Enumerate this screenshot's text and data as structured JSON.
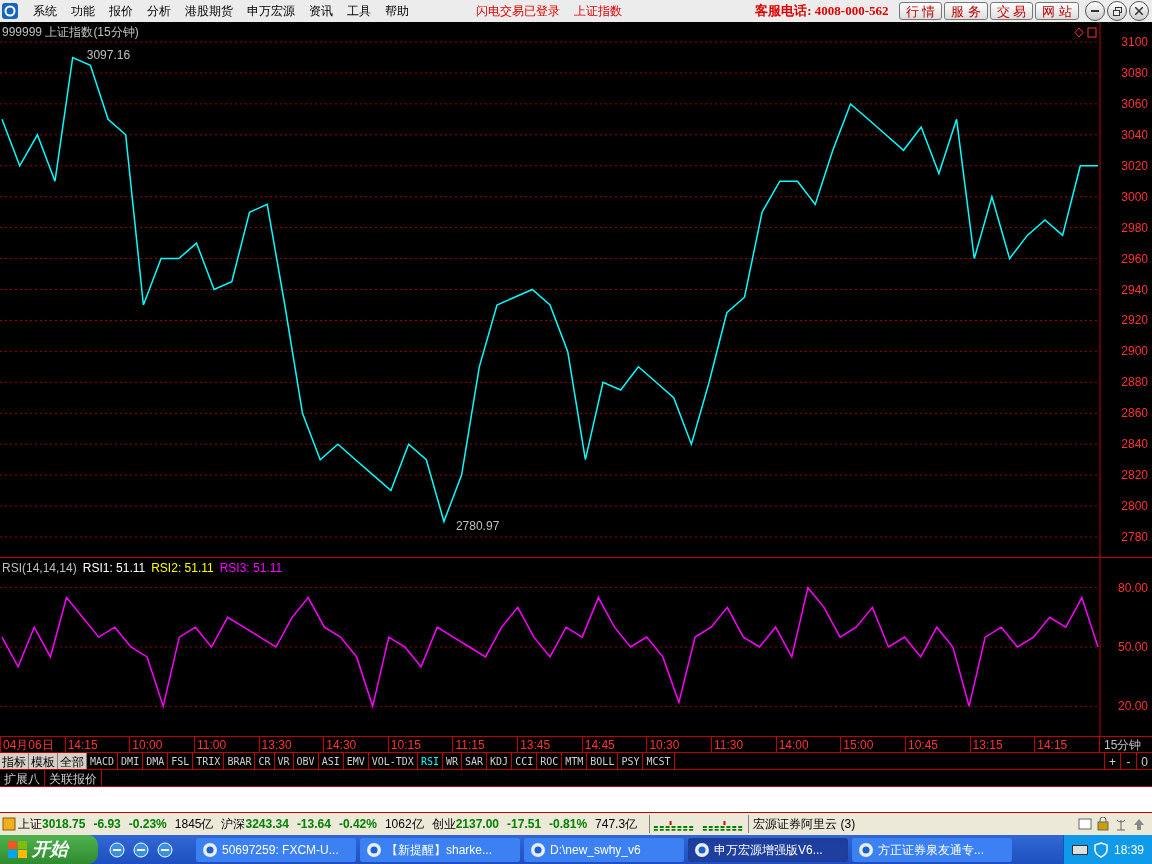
{
  "menu": {
    "items": [
      "系统",
      "功能",
      "报价",
      "分析",
      "港股期货",
      "申万宏源",
      "资讯",
      "工具",
      "帮助"
    ],
    "status": [
      "闪电交易已登录",
      "上证指数"
    ],
    "hotline": "客服电话: 4008-000-562",
    "buttons": [
      "行 情",
      "服 务",
      "交 易",
      "网 站"
    ]
  },
  "price_panel": {
    "title": "999999 上证指数(15分钟)",
    "high_label": "3097.16",
    "low_label": "2780.97",
    "chart_data": {
      "type": "line",
      "grid": true,
      "ylim": [
        2780,
        3100
      ],
      "yticks": [
        2780,
        2800,
        2820,
        2840,
        2860,
        2880,
        2900,
        2920,
        2940,
        2960,
        2980,
        3000,
        3020,
        3040,
        3060,
        3080,
        3100
      ],
      "series": [
        {
          "color": "#00ffff",
          "values": [
            3050,
            3020,
            3040,
            3010,
            3090,
            3085,
            3050,
            3040,
            2930,
            2960,
            2960,
            2970,
            2940,
            2945,
            2990,
            2995,
            2930,
            2860,
            2830,
            2840,
            2830,
            2820,
            2810,
            2840,
            2830,
            2790,
            2820,
            2890,
            2930,
            2935,
            2940,
            2930,
            2900,
            2830,
            2880,
            2875,
            2890,
            2880,
            2870,
            2840,
            2880,
            2925,
            2935,
            2990,
            3010,
            3010,
            2995,
            3030,
            3060,
            3050,
            3040,
            3030,
            3045,
            3015,
            3050,
            2960,
            3000,
            2960,
            2975,
            2985,
            2975,
            3020,
            3020
          ]
        }
      ]
    }
  },
  "rsi_panel": {
    "legend": [
      {
        "label": "RSI(14,14,14)",
        "color": "#c0c0c0"
      },
      {
        "label": "RSI1: 51.11",
        "color": "#ffffff"
      },
      {
        "label": "RSI2: 51.11",
        "color": "#ffff00"
      },
      {
        "label": "RSI3: 51.11",
        "color": "#ff00ff"
      }
    ],
    "chart_data": {
      "type": "line",
      "grid": true,
      "ylim": [
        5,
        95
      ],
      "yticks": [
        {
          "value": 20,
          "label": "20.00"
        },
        {
          "value": 50,
          "label": "50.00"
        },
        {
          "value": 80,
          "label": "80.00"
        }
      ],
      "series": [
        {
          "color": "#ff00ff",
          "values": [
            55,
            40,
            60,
            45,
            75,
            65,
            55,
            60,
            50,
            45,
            20,
            55,
            60,
            50,
            65,
            60,
            55,
            50,
            65,
            75,
            60,
            55,
            45,
            20,
            55,
            50,
            40,
            60,
            55,
            50,
            45,
            60,
            70,
            55,
            45,
            60,
            55,
            75,
            60,
            50,
            55,
            45,
            22,
            55,
            60,
            70,
            55,
            50,
            60,
            45,
            80,
            70,
            55,
            60,
            70,
            50,
            55,
            45,
            60,
            50,
            20,
            55,
            60,
            50,
            55,
            65,
            60,
            75,
            50
          ]
        }
      ]
    }
  },
  "time_axis": {
    "labels": [
      "04月06日",
      "14:15",
      "10:00",
      "11:00",
      "13:30",
      "14:30",
      "10:15",
      "11:15",
      "13:45",
      "14:45",
      "10:30",
      "11:30",
      "14:00",
      "15:00",
      "10:45",
      "13:15",
      "14:15"
    ],
    "period": "15分钟"
  },
  "indicator_tabs": {
    "groups": [
      "指标",
      "模板",
      "全部"
    ],
    "tabs": [
      {
        "label": "MACD",
        "selected": false
      },
      {
        "label": "DMI",
        "selected": false
      },
      {
        "label": "DMA",
        "selected": false
      },
      {
        "label": "FSL",
        "selected": false
      },
      {
        "label": "TRIX",
        "selected": false
      },
      {
        "label": "BRAR",
        "selected": false
      },
      {
        "label": "CR",
        "selected": false
      },
      {
        "label": "VR",
        "selected": false
      },
      {
        "label": "OBV",
        "selected": false
      },
      {
        "label": "ASI",
        "selected": false
      },
      {
        "label": "EMV",
        "selected": false
      },
      {
        "label": "VOL-TDX",
        "selected": false
      },
      {
        "label": "RSI",
        "selected": true
      },
      {
        "label": "WR",
        "selected": false
      },
      {
        "label": "SAR",
        "selected": false
      },
      {
        "label": "KDJ",
        "selected": false
      },
      {
        "label": "CCI",
        "selected": false
      },
      {
        "label": "ROC",
        "selected": false
      },
      {
        "label": "MTM",
        "selected": false
      },
      {
        "label": "BOLL",
        "selected": false
      },
      {
        "label": "PSY",
        "selected": false
      },
      {
        "label": "MCST",
        "selected": false
      }
    ],
    "zoom": [
      "+",
      "-",
      "0"
    ]
  },
  "bottom_tabs": [
    "扩展八",
    "关联报价"
  ],
  "status_bar": {
    "indices": [
      {
        "name": "上证",
        "value": "3018.75",
        "change": "-6.93",
        "pct": "-0.23%",
        "amount": "1845亿"
      },
      {
        "name": "沪深",
        "value": "3243.34",
        "change": "-13.64",
        "pct": "-0.42%",
        "amount": "1062亿"
      },
      {
        "name": "创业",
        "value": "2137.00",
        "change": "-17.51",
        "pct": "-0.81%",
        "amount": "747.3亿"
      }
    ],
    "server": "宏源证券阿里云 (3)"
  },
  "taskbar": {
    "start": "开始",
    "tasks": [
      {
        "label": "50697259: FXCM-U...",
        "selected": false
      },
      {
        "label": "【新提醒】sharke...",
        "selected": false
      },
      {
        "label": "D:\\new_swhy_v6",
        "selected": false
      },
      {
        "label": "申万宏源增强版V6...",
        "selected": true
      },
      {
        "label": "方正证券泉友通专...",
        "selected": false
      }
    ],
    "clock": "18:39"
  }
}
